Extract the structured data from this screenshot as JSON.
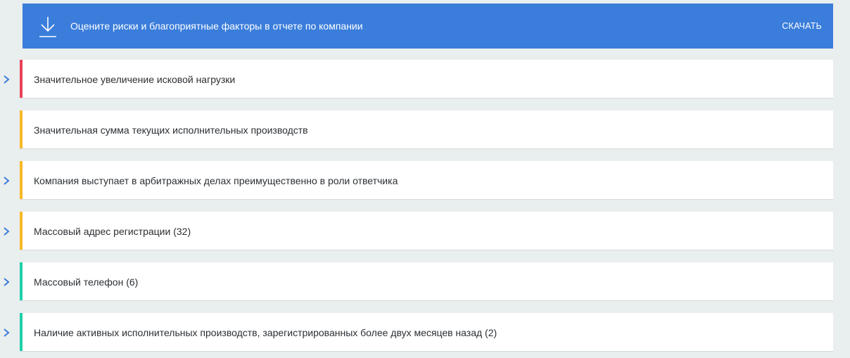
{
  "banner": {
    "text": "Оцените риски и благоприятные факторы в отчете по компании",
    "download_label": "СКАЧАТЬ",
    "icon": "download-icon",
    "background_color": "#3a7ddb"
  },
  "colors": {
    "red": "#e8425a",
    "yellow": "#f6b826",
    "green": "#1fcfa8",
    "chevron": "#3a7ddb"
  },
  "risks": [
    {
      "text": "Значительное увеличение исковой нагрузки",
      "level": "red",
      "expandable": true
    },
    {
      "text": "Значительная сумма текущих исполнительных производств",
      "level": "yellow",
      "expandable": false
    },
    {
      "text": "Компания выступает в арбитражных делах преимущественно в роли ответчика",
      "level": "yellow",
      "expandable": true
    },
    {
      "text": "Массовый адрес регистрации (32)",
      "level": "yellow",
      "expandable": true
    },
    {
      "text": "Массовый телефон (6)",
      "level": "green",
      "expandable": true
    },
    {
      "text": "Наличие активных исполнительных производств, зарегистрированных более двух месяцев назад (2)",
      "level": "green",
      "expandable": true
    }
  ]
}
